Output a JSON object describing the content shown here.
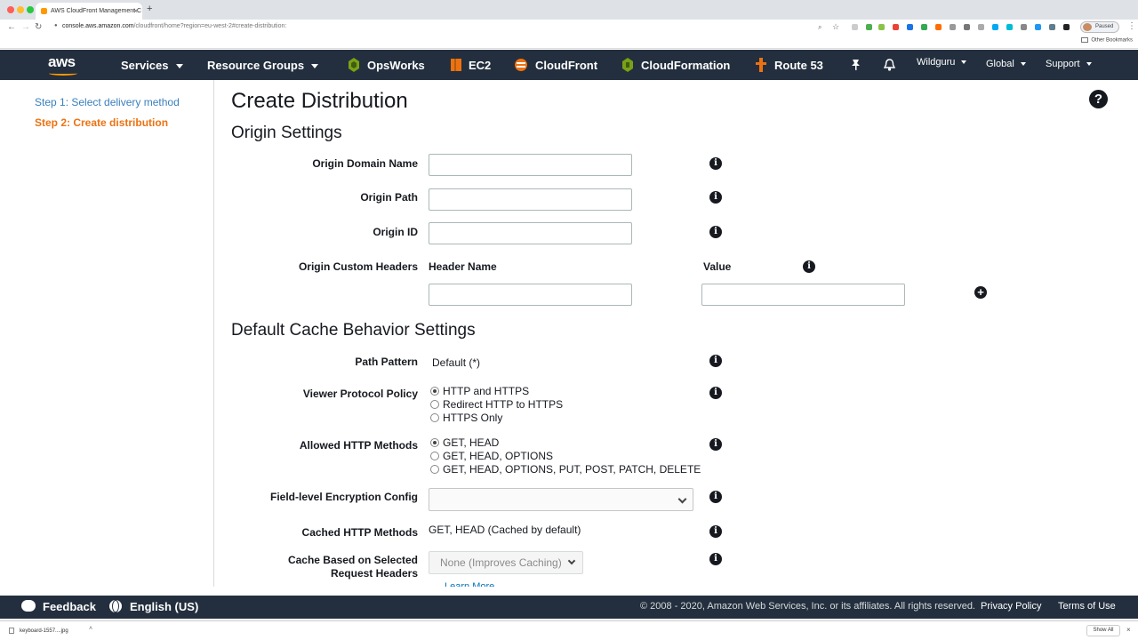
{
  "browser": {
    "tab_title": "AWS CloudFront Management C",
    "tab_close": "×",
    "new_tab": "+",
    "url_host": "console.aws.amazon.com",
    "url_path": "/cloudfront/home?region=eu-west-2#create-distribution:",
    "profile_status": "Paused",
    "other_bookmarks": "Other Bookmarks",
    "download_file": "keyboard-1557....jpg",
    "show_all": "Show All",
    "download_close": "×"
  },
  "nav": {
    "logo": "aws",
    "services": "Services",
    "resource_groups": "Resource Groups",
    "opsworks": "OpsWorks",
    "ec2": "EC2",
    "cloudfront": "CloudFront",
    "cloudformation": "CloudFormation",
    "route53": "Route 53",
    "account": "Wildguru",
    "region": "Global",
    "support": "Support"
  },
  "sidebar": {
    "step1": "Step 1: Select delivery method",
    "step2": "Step 2: Create distribution"
  },
  "page": {
    "title": "Create Distribution",
    "help_icon": "?"
  },
  "origin": {
    "heading": "Origin Settings",
    "domain_label": "Origin Domain Name",
    "domain_value": "",
    "path_label": "Origin Path",
    "path_value": "",
    "id_label": "Origin ID",
    "id_value": "",
    "custom_headers_label": "Origin Custom Headers",
    "header_name_col": "Header Name",
    "value_col": "Value",
    "header_name_value": "",
    "header_value_value": ""
  },
  "cache": {
    "heading": "Default Cache Behavior Settings",
    "path_pattern_label": "Path Pattern",
    "path_pattern_value": "Default (*)",
    "viewer_protocol_label": "Viewer Protocol Policy",
    "viewer_protocol_options": [
      "HTTP and HTTPS",
      "Redirect HTTP to HTTPS",
      "HTTPS Only"
    ],
    "viewer_protocol_selected": 0,
    "allowed_methods_label": "Allowed HTTP Methods",
    "allowed_methods_options": [
      "GET, HEAD",
      "GET, HEAD, OPTIONS",
      "GET, HEAD, OPTIONS, PUT, POST, PATCH, DELETE"
    ],
    "allowed_methods_selected": 0,
    "fle_label": "Field-level Encryption Config",
    "fle_value": "",
    "cached_methods_label": "Cached HTTP Methods",
    "cached_methods_value": "GET, HEAD (Cached by default)",
    "cache_headers_label_line1": "Cache Based on Selected",
    "cache_headers_label_line2": "Request Headers",
    "cache_headers_value": "None (Improves Caching)",
    "learn_more": "Learn More"
  },
  "icons": {
    "info": "i",
    "add": "+"
  },
  "footer": {
    "feedback": "Feedback",
    "language": "English (US)",
    "copyright": "© 2008 - 2020, Amazon Web Services, Inc. or its affiliates. All rights reserved.",
    "privacy": "Privacy Policy",
    "terms": "Terms of Use"
  },
  "colors": {
    "nav_bg": "#232f3e",
    "accent_orange": "#ec7211",
    "link_blue": "#3a7fbd"
  }
}
